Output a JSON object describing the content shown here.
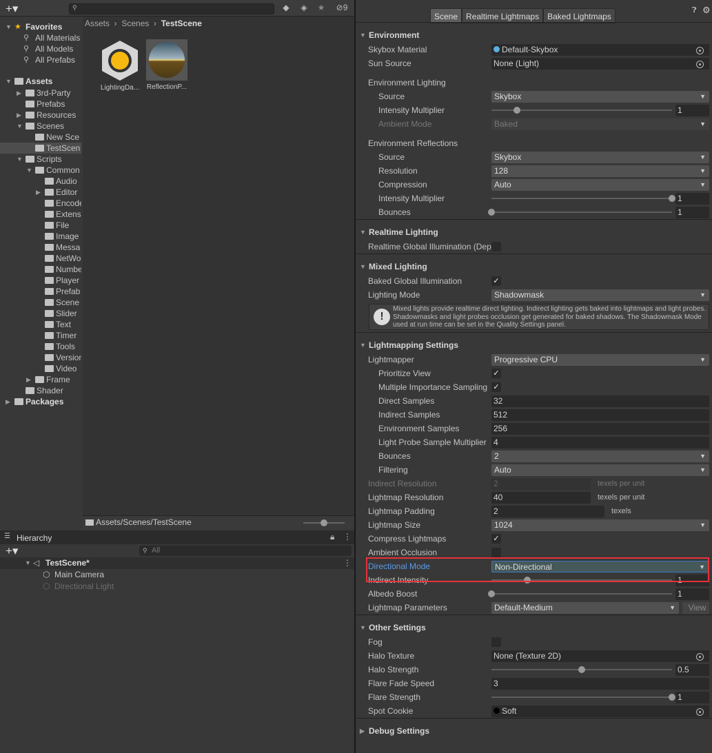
{
  "project": {
    "add_label": "+▾",
    "search_placeholder": "",
    "toolbar_icons": [
      "filter-by-type-icon",
      "filter-by-label-icon",
      "favorite-star-icon",
      "hidden-packages-icon"
    ],
    "hidden_count": "9",
    "breadcrumb": [
      "Assets",
      "Scenes",
      "TestScene"
    ],
    "assets": [
      {
        "name": "LightingDa...",
        "icon": "lighting-data-icon"
      },
      {
        "name": "ReflectionP...",
        "icon": "reflection-probe-icon"
      }
    ],
    "path": "Assets/Scenes/TestScene",
    "zoom_slider_fraction": 0.5,
    "tree": [
      {
        "label": "Favorites",
        "depth": 0,
        "arrow": "open",
        "icon": "star",
        "bold": true
      },
      {
        "label": "All Materials",
        "depth": 1,
        "arrow": "none",
        "icon": "search"
      },
      {
        "label": "All Models",
        "depth": 1,
        "arrow": "none",
        "icon": "search"
      },
      {
        "label": "All Prefabs",
        "depth": 1,
        "arrow": "none",
        "icon": "search"
      },
      {
        "label": "Assets",
        "depth": 0,
        "arrow": "open",
        "icon": "folder",
        "bold": true
      },
      {
        "label": "3rd-Party",
        "depth": 1,
        "arrow": "closed",
        "icon": "folder"
      },
      {
        "label": "Prefabs",
        "depth": 1,
        "arrow": "none",
        "icon": "folder"
      },
      {
        "label": "Resources",
        "depth": 1,
        "arrow": "closed",
        "icon": "folder"
      },
      {
        "label": "Scenes",
        "depth": 1,
        "arrow": "open",
        "icon": "folder"
      },
      {
        "label": "New Sce",
        "depth": 2,
        "arrow": "none",
        "icon": "folder"
      },
      {
        "label": "TestScen",
        "depth": 2,
        "arrow": "none",
        "icon": "folder",
        "selected": true
      },
      {
        "label": "Scripts",
        "depth": 1,
        "arrow": "open",
        "icon": "folder"
      },
      {
        "label": "Common",
        "depth": 2,
        "arrow": "open",
        "icon": "folder"
      },
      {
        "label": "Audio",
        "depth": 3,
        "arrow": "none",
        "icon": "folder"
      },
      {
        "label": "Editor",
        "depth": 3,
        "arrow": "closed",
        "icon": "folder"
      },
      {
        "label": "Encode",
        "depth": 3,
        "arrow": "none",
        "icon": "folder"
      },
      {
        "label": "Extens",
        "depth": 3,
        "arrow": "none",
        "icon": "folder"
      },
      {
        "label": "File",
        "depth": 3,
        "arrow": "none",
        "icon": "folder"
      },
      {
        "label": "Image",
        "depth": 3,
        "arrow": "none",
        "icon": "folder"
      },
      {
        "label": "Messa",
        "depth": 3,
        "arrow": "none",
        "icon": "folder"
      },
      {
        "label": "NetWo",
        "depth": 3,
        "arrow": "none",
        "icon": "folder"
      },
      {
        "label": "Numbe",
        "depth": 3,
        "arrow": "none",
        "icon": "folder"
      },
      {
        "label": "Player",
        "depth": 3,
        "arrow": "none",
        "icon": "folder"
      },
      {
        "label": "Prefab",
        "depth": 3,
        "arrow": "none",
        "icon": "folder"
      },
      {
        "label": "Scene",
        "depth": 3,
        "arrow": "none",
        "icon": "folder"
      },
      {
        "label": "Slider",
        "depth": 3,
        "arrow": "none",
        "icon": "folder"
      },
      {
        "label": "Text",
        "depth": 3,
        "arrow": "none",
        "icon": "folder"
      },
      {
        "label": "Timer",
        "depth": 3,
        "arrow": "none",
        "icon": "folder"
      },
      {
        "label": "Tools",
        "depth": 3,
        "arrow": "none",
        "icon": "folder"
      },
      {
        "label": "Version",
        "depth": 3,
        "arrow": "none",
        "icon": "folder"
      },
      {
        "label": "Video",
        "depth": 3,
        "arrow": "none",
        "icon": "folder"
      },
      {
        "label": "Frame",
        "depth": 2,
        "arrow": "closed",
        "icon": "folder"
      },
      {
        "label": "Shader",
        "depth": 1,
        "arrow": "none",
        "icon": "folder"
      },
      {
        "label": "Packages",
        "depth": 0,
        "arrow": "closed",
        "icon": "folder",
        "bold": true
      }
    ]
  },
  "hierarchy": {
    "tab_label": "Hierarchy",
    "add_label": "+▾",
    "search_placeholder": "All",
    "items": [
      {
        "label": "TestScene*",
        "depth": 0,
        "icon": "unity-scene-icon",
        "bold": true
      },
      {
        "label": "Main Camera",
        "depth": 1,
        "icon": "gameobject-icon"
      },
      {
        "label": "Directional Light",
        "depth": 1,
        "icon": "gameobject-icon",
        "disabled": true
      }
    ]
  },
  "lighting": {
    "tabs": [
      {
        "label": "Scene",
        "active": true
      },
      {
        "label": "Realtime Lightmaps"
      },
      {
        "label": "Baked Lightmaps"
      }
    ],
    "help_icon": "help-icon",
    "settings_icon": "gear-icon",
    "sections": [
      {
        "title": "Environment",
        "open": true,
        "rows": [
          {
            "label": "Skybox Material",
            "kind": "object",
            "value": "Default-Skybox",
            "obj_icon": "skybox-material-icon"
          },
          {
            "label": "Sun Source",
            "kind": "object",
            "value": "None (Light)"
          },
          {
            "kind": "spacer"
          },
          {
            "label": "Environment Lighting",
            "kind": "label"
          },
          {
            "label": "Source",
            "indent": 1,
            "kind": "dropdown",
            "value": "Skybox"
          },
          {
            "label": "Intensity Multiplier",
            "indent": 1,
            "kind": "slider",
            "value": "1",
            "fraction": 0.14
          },
          {
            "label": "Ambient Mode",
            "indent": 1,
            "kind": "dropdown",
            "value": "Baked",
            "disabled": true
          },
          {
            "kind": "spacer"
          },
          {
            "label": "Environment Reflections",
            "kind": "label"
          },
          {
            "label": "Source",
            "indent": 1,
            "kind": "dropdown",
            "value": "Skybox"
          },
          {
            "label": "Resolution",
            "indent": 1,
            "kind": "dropdown",
            "value": "128"
          },
          {
            "label": "Compression",
            "indent": 1,
            "kind": "dropdown",
            "value": "Auto"
          },
          {
            "label": "Intensity Multiplier",
            "indent": 1,
            "kind": "slider",
            "value": "1",
            "fraction": 1
          },
          {
            "label": "Bounces",
            "indent": 1,
            "kind": "slider",
            "value": "1",
            "fraction": 0
          }
        ]
      },
      {
        "title": "Realtime Lighting",
        "open": true,
        "rows": [
          {
            "label": "Realtime Global Illumination (Deprecated)",
            "kind": "checkbox",
            "checked": false
          }
        ]
      },
      {
        "title": "Mixed Lighting",
        "open": true,
        "rows": [
          {
            "label": "Baked Global Illumination",
            "kind": "checkbox",
            "checked": true
          },
          {
            "label": "Lighting Mode",
            "kind": "dropdown",
            "value": "Shadowmask"
          },
          {
            "kind": "help",
            "text": "Mixed lights provide realtime direct lighting. Indirect lighting gets baked into lightmaps and light probes. Shadowmasks and light probes occlusion get generated for baked shadows. The Shadowmask Mode used at run time can be set in the Quality Settings panel."
          }
        ]
      },
      {
        "title": "Lightmapping Settings",
        "open": true,
        "rows": [
          {
            "label": "Lightmapper",
            "kind": "dropdown",
            "value": "Progressive CPU"
          },
          {
            "label": "Prioritize View",
            "indent": 1,
            "kind": "checkbox",
            "checked": true
          },
          {
            "label": "Multiple Importance Sampling",
            "indent": 1,
            "kind": "checkbox",
            "checked": true
          },
          {
            "label": "Direct Samples",
            "indent": 1,
            "kind": "text",
            "value": "32"
          },
          {
            "label": "Indirect Samples",
            "indent": 1,
            "kind": "text",
            "value": "512"
          },
          {
            "label": "Environment Samples",
            "indent": 1,
            "kind": "text",
            "value": "256"
          },
          {
            "label": "Light Probe Sample Multiplier",
            "indent": 1,
            "kind": "text",
            "value": "4"
          },
          {
            "label": "Bounces",
            "indent": 1,
            "kind": "dropdown",
            "value": "2"
          },
          {
            "label": "Filtering",
            "indent": 1,
            "kind": "dropdown",
            "value": "Auto"
          },
          {
            "label": "Indirect Resolution",
            "kind": "suffix",
            "value": "2",
            "suffix": "texels per unit",
            "disabled": true
          },
          {
            "label": "Lightmap Resolution",
            "kind": "suffix",
            "value": "40",
            "suffix": "texels per unit"
          },
          {
            "label": "Lightmap Padding",
            "kind": "suffix2",
            "value": "2",
            "suffix": "texels"
          },
          {
            "label": "Lightmap Size",
            "kind": "dropdown",
            "value": "1024"
          },
          {
            "label": "Compress Lightmaps",
            "kind": "checkbox",
            "checked": true
          },
          {
            "label": "Ambient Occlusion",
            "kind": "checkbox",
            "checked": false
          },
          {
            "label": "Directional Mode",
            "kind": "dropdown",
            "value": "Non-Directional",
            "highlighted": true
          },
          {
            "label": "Indirect Intensity",
            "kind": "slider",
            "value": "1",
            "fraction": 0.2
          },
          {
            "label": "Albedo Boost",
            "kind": "slider",
            "value": "1",
            "fraction": 0
          },
          {
            "label": "Lightmap Parameters",
            "kind": "params",
            "value": "Default-Medium",
            "button": "View"
          }
        ]
      },
      {
        "title": "Other Settings",
        "open": true,
        "rows": [
          {
            "label": "Fog",
            "kind": "checkbox",
            "checked": false
          },
          {
            "label": "Halo Texture",
            "kind": "object",
            "value": "None (Texture 2D)"
          },
          {
            "label": "Halo Strength",
            "kind": "slider",
            "value": "0.5",
            "fraction": 0.5
          },
          {
            "label": "Flare Fade Speed",
            "kind": "text",
            "value": "3"
          },
          {
            "label": "Flare Strength",
            "kind": "slider",
            "value": "1",
            "fraction": 1
          },
          {
            "label": "Spot Cookie",
            "kind": "object",
            "value": "Soft",
            "obj_icon": "texture-icon"
          }
        ]
      },
      {
        "title": "Debug Settings",
        "open": false,
        "rows": []
      }
    ]
  },
  "colors": {
    "highlight_box": "#e8313a",
    "label_focus": "#5c9ae6",
    "selection": "#4d4d4d",
    "folder_icon": "#c2c2c2",
    "lighting_icon": "#f7b811"
  }
}
